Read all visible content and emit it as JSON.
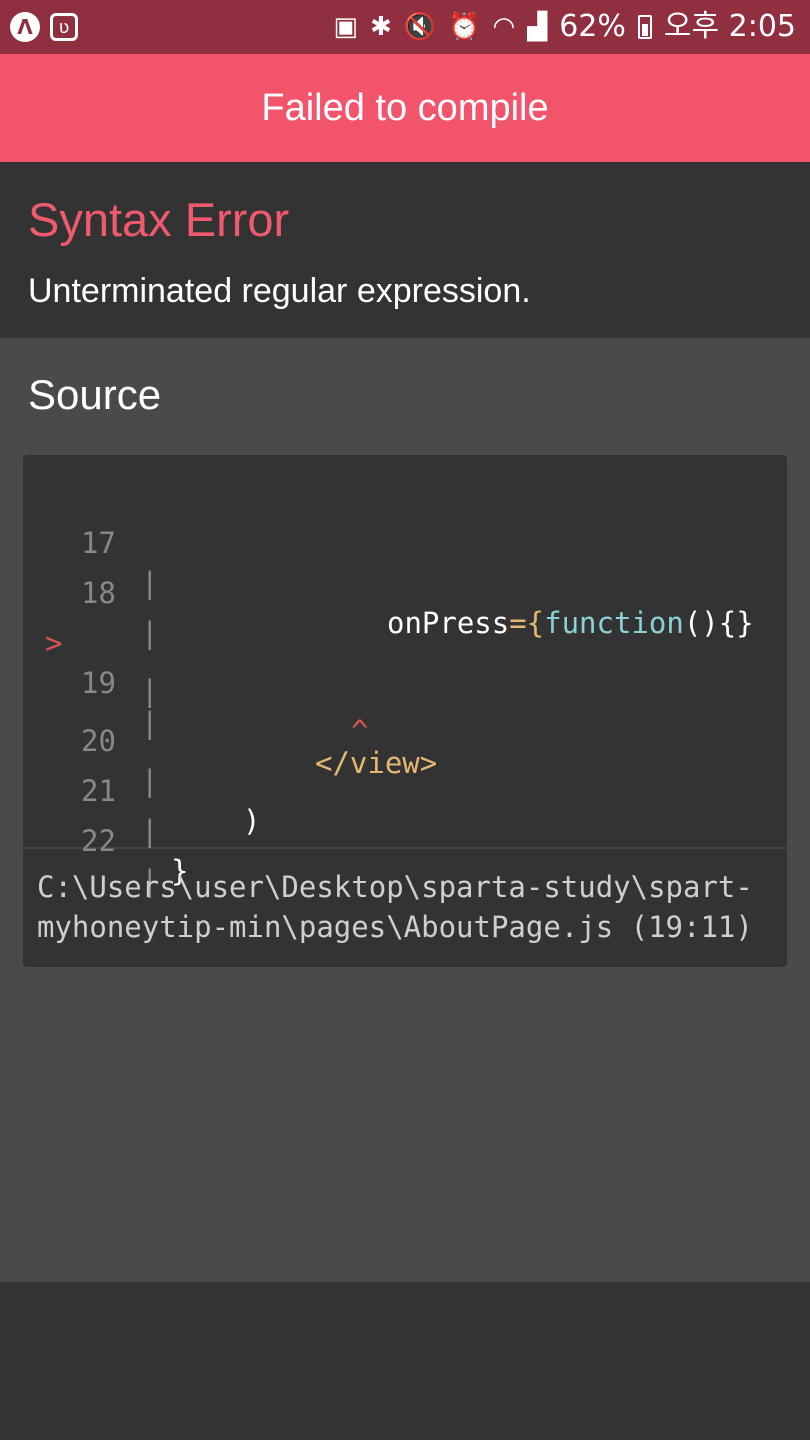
{
  "status_bar": {
    "left_icons": [
      "app-a-icon",
      "app-phone-icon"
    ],
    "battery_percent": "62%",
    "time": "오후 2:05",
    "right_icons": [
      "sim-icon",
      "bluetooth-icon",
      "mute-icon",
      "alarm-icon",
      "wifi-icon",
      "signal-icon",
      "battery-icon"
    ]
  },
  "header": {
    "title": "Failed to compile"
  },
  "error": {
    "title": "Syntax Error",
    "message": "Unterminated regular expression."
  },
  "source": {
    "title": "Source",
    "lines": [
      {
        "num": "17",
        "marker": "",
        "code_prefix": "onPress",
        "code_punct1": "={",
        "code_fn": "function",
        "code_rest": "(){}"
      },
      {
        "num": "18",
        "marker": ""
      },
      {
        "num": "19",
        "marker": ">",
        "code_tag": "</view>"
      },
      {
        "num": "",
        "marker": "",
        "caret": "^"
      },
      {
        "num": "20",
        "marker": "",
        "code": ")"
      },
      {
        "num": "21",
        "marker": "",
        "code": "}"
      },
      {
        "num": "22",
        "marker": ""
      }
    ],
    "file_path_line1": "C:\\Users\\user\\Desktop\\sparta-study\\spart-",
    "file_path_line2": "myhoneytip-min\\pages\\AboutPage.js (19:11)"
  },
  "colors": {
    "header_bg": "#f2556b",
    "status_bar_bg": "#8f2f3f",
    "error_title": "#ef5a6f",
    "keyword": "#8ad2d5",
    "punct": "#e3b871",
    "marker": "#d9534f"
  }
}
